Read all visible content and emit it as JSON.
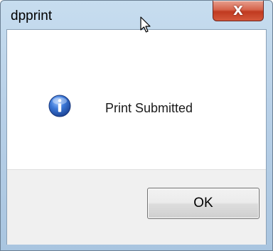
{
  "window": {
    "title": "dpprint",
    "close_glyph": "X"
  },
  "dialog": {
    "icon": "info-icon",
    "message": "Print Submitted",
    "ok_label": "OK"
  },
  "colors": {
    "close_button": "#c9452a",
    "titlebar": "#b9d1e8",
    "info_icon": "#2b63c5"
  }
}
